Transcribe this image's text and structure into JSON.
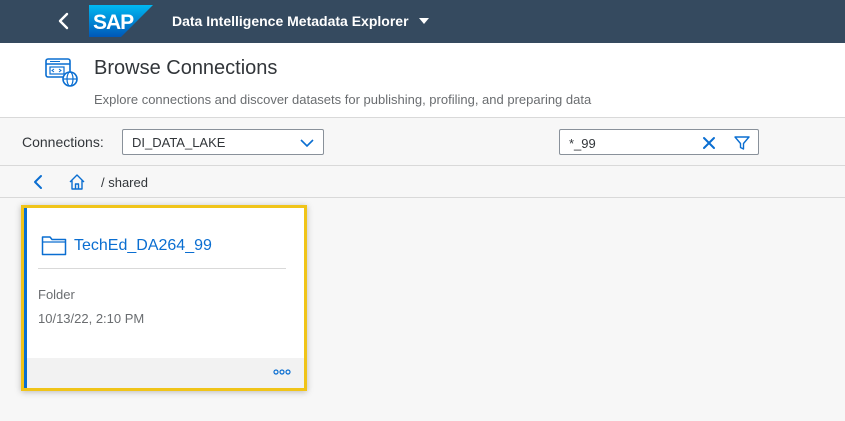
{
  "shell": {
    "logo_text": "SAP",
    "app_title": "Data Intelligence Metadata Explorer"
  },
  "header": {
    "title": "Browse Connections",
    "subtitle": "Explore connections and discover datasets for publishing, profiling, and preparing data"
  },
  "filters": {
    "connections_label": "Connections:",
    "connection_value": "DI_DATA_LAKE",
    "search_value": "*_99"
  },
  "breadcrumb": {
    "path": "/ shared"
  },
  "cards": [
    {
      "name": "TechEd_DA264_99",
      "type": "Folder",
      "modified": "10/13/22, 2:10 PM",
      "icon": "folder-icon"
    }
  ],
  "colors": {
    "shell_bg": "#354a5f",
    "accent": "#0a6ed1",
    "highlight": "#f0c419"
  }
}
